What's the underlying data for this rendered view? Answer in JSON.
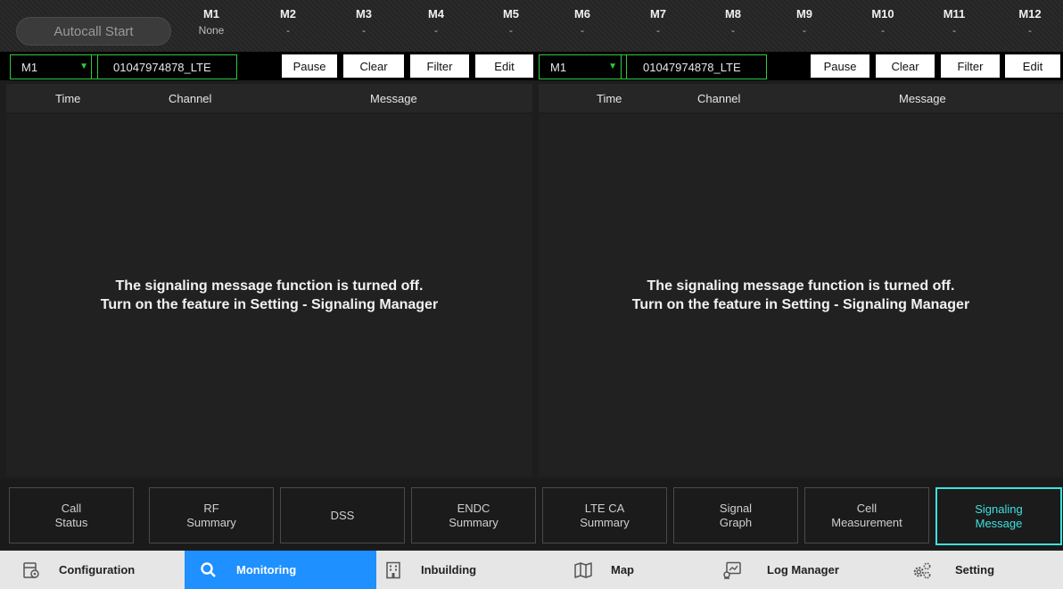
{
  "header": {
    "autocall_label": "Autocall Start",
    "modules": [
      {
        "name": "M1",
        "value": "None"
      },
      {
        "name": "M2",
        "value": "-"
      },
      {
        "name": "M3",
        "value": "-"
      },
      {
        "name": "M4",
        "value": "-"
      },
      {
        "name": "M5",
        "value": "-"
      },
      {
        "name": "M6",
        "value": "-"
      },
      {
        "name": "M7",
        "value": "-"
      },
      {
        "name": "M8",
        "value": "-"
      },
      {
        "name": "M9",
        "value": "-"
      },
      {
        "name": "M10",
        "value": "-"
      },
      {
        "name": "M11",
        "value": "-"
      },
      {
        "name": "M12",
        "value": "-"
      }
    ]
  },
  "left_panel": {
    "module_select": "M1",
    "phone": "01047974878_LTE",
    "buttons": {
      "pause": "Pause",
      "clear": "Clear",
      "filter": "Filter",
      "edit": "Edit"
    },
    "columns": {
      "time": "Time",
      "channel": "Channel",
      "message": "Message"
    },
    "notice_line1": "The signaling message function is turned off.",
    "notice_line2": "Turn on the feature in Setting - Signaling Manager"
  },
  "right_panel": {
    "module_select": "M1",
    "phone": "01047974878_LTE",
    "buttons": {
      "pause": "Pause",
      "clear": "Clear",
      "filter": "Filter",
      "edit": "Edit"
    },
    "columns": {
      "time": "Time",
      "channel": "Channel",
      "message": "Message"
    },
    "notice_line1": "The signaling message function is turned off.",
    "notice_line2": "Turn on the feature in Setting - Signaling Manager"
  },
  "sub_tabs": [
    {
      "line1": "Call",
      "line2": "Status"
    },
    {
      "line1": "RF",
      "line2": "Summary"
    },
    {
      "line1": "DSS",
      "line2": ""
    },
    {
      "line1": "ENDC",
      "line2": "Summary"
    },
    {
      "line1": "LTE CA",
      "line2": "Summary"
    },
    {
      "line1": "Signal",
      "line2": "Graph"
    },
    {
      "line1": "Cell",
      "line2": "Measurement"
    },
    {
      "line1": "Signaling",
      "line2": "Message"
    }
  ],
  "active_sub_tab": "Signaling Message",
  "nav": {
    "configuration": "Configuration",
    "monitoring": "Monitoring",
    "inbuilding": "Inbuilding",
    "map": "Map",
    "log_manager": "Log Manager",
    "setting": "Setting"
  },
  "colors": {
    "accent_green": "#2ecc40",
    "accent_cyan": "#3ee0de",
    "nav_active": "#1e90ff"
  }
}
